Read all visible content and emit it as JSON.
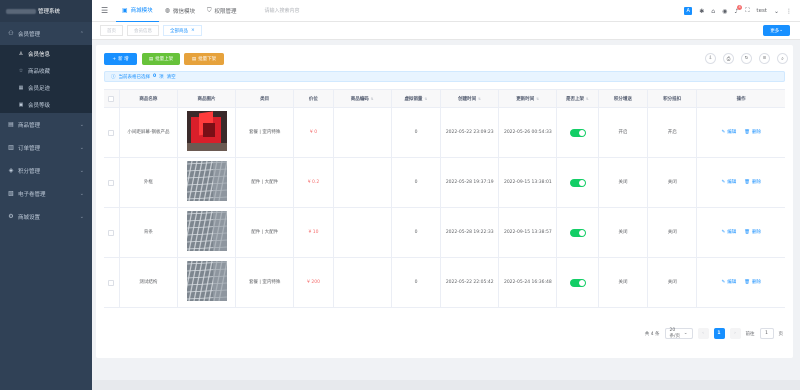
{
  "app": {
    "title_suffix": "管理系统"
  },
  "sidebar": {
    "items": [
      {
        "label": "会员管理",
        "icon": "user-group-icon",
        "expanded": true
      },
      {
        "label": "会员信息",
        "icon": "user-icon",
        "sub": true,
        "active": true
      },
      {
        "label": "商品收藏",
        "icon": "star-icon",
        "sub": true
      },
      {
        "label": "会员足迹",
        "icon": "footprint-icon",
        "sub": true
      },
      {
        "label": "会员等级",
        "icon": "level-icon",
        "sub": true
      },
      {
        "label": "商品管理",
        "icon": "goods-icon"
      },
      {
        "label": "订单管理",
        "icon": "order-icon"
      },
      {
        "label": "积分管理",
        "icon": "points-icon"
      },
      {
        "label": "电子卷管理",
        "icon": "coupon-icon"
      },
      {
        "label": "商城设置",
        "icon": "settings-icon"
      }
    ]
  },
  "header": {
    "tabs": [
      {
        "label": "商城模块",
        "icon": "shop-icon",
        "active": true
      },
      {
        "label": "微信模块",
        "icon": "wechat-icon"
      },
      {
        "label": "权限管理",
        "icon": "shield-icon"
      }
    ],
    "search_placeholder": "请输入搜索内容",
    "user": "test",
    "notification_count": "4"
  },
  "tags": {
    "items": [
      {
        "label": "首页"
      },
      {
        "label": "会员信息"
      },
      {
        "label": "全部商品",
        "active": true
      }
    ],
    "more_label": "更多"
  },
  "toolbar": {
    "add_label": "新 增",
    "shelve_label": "批量上架",
    "unshelve_label": "批量下架"
  },
  "alert": {
    "prefix": "当前表格已选择",
    "count": "0",
    "unit": "项",
    "clear": "清空"
  },
  "table": {
    "headers": [
      "商品名称",
      "商品图片",
      "类目",
      "价位",
      "商品编码",
      "虚拟销量",
      "创建时间",
      "更新时间",
      "是否上架",
      "积分增送",
      "积分抵扣",
      "操作"
    ],
    "edit_label": "编辑",
    "delete_label": "删除",
    "rows": [
      {
        "name": "小间距屏幕-钢板产品",
        "category": "套餐 | 室内特殊",
        "price": "¥ 0",
        "code": "",
        "sales": "0",
        "created": "2022-05-22 23:09:23",
        "updated": "2022-05-26 00:54:33",
        "on_shelf": true,
        "points_gift": "开启",
        "points_deduct": "开启",
        "image": "red-panel"
      },
      {
        "name": "外框",
        "category": "配件 | 大配件",
        "price": "¥ 0.2",
        "code": "",
        "sales": "0",
        "created": "2022-05-28 19:37:19",
        "updated": "2022-09-15 13:38:01",
        "on_shelf": true,
        "points_gift": "关闭",
        "points_deduct": "关闭",
        "image": "steel-frame"
      },
      {
        "name": "背条",
        "category": "配件 | 大配件",
        "price": "¥ 10",
        "code": "",
        "sales": "0",
        "created": "2022-05-28 19:22:33",
        "updated": "2022-09-15 13:38:57",
        "on_shelf": true,
        "points_gift": "关闭",
        "points_deduct": "关闭",
        "image": "steel-frame"
      },
      {
        "name": "测试结构",
        "category": "套餐 | 室内特殊",
        "price": "¥ 200",
        "code": "",
        "sales": "0",
        "created": "2022-05-22 22:05:42",
        "updated": "2022-05-24 16:36:48",
        "on_shelf": true,
        "points_gift": "关闭",
        "points_deduct": "关闭",
        "image": "steel-frame"
      }
    ]
  },
  "pagination": {
    "total": "共 4 条",
    "page_size": "20条/页",
    "current": "1",
    "goto_label": "前往",
    "goto_value": "1",
    "page_unit": "页"
  },
  "colors": {
    "primary": "#1890ff",
    "success": "#67c23a",
    "warning": "#e6a23c",
    "danger": "#f56c6c",
    "sidebar": "#304156"
  }
}
